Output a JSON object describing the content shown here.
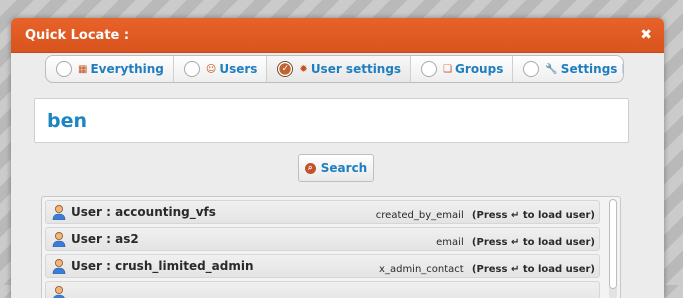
{
  "dialog": {
    "title": "Quick Locate :",
    "close_icon": "close-icon"
  },
  "tabs": [
    {
      "label": "Everything",
      "icon": "grid-icon",
      "selected": false
    },
    {
      "label": "Users",
      "icon": "user-icon",
      "selected": false
    },
    {
      "label": "User settings",
      "icon": "gear-icon",
      "selected": true
    },
    {
      "label": "Groups",
      "icon": "groups-icon",
      "selected": false
    },
    {
      "label": "Settings Panel",
      "icon": "wrench-icon",
      "selected": false
    }
  ],
  "search": {
    "value": "ben",
    "button_label": "Search",
    "button_icon": "search-icon"
  },
  "results": [
    {
      "label": "User : accounting_vfs",
      "field": "created_by_email",
      "hint_pre": "(Press",
      "hint_key": "↵",
      "hint_post": "to load user)"
    },
    {
      "label": "User : as2",
      "field": "email",
      "hint_pre": "(Press",
      "hint_key": "↵",
      "hint_post": "to load user)"
    },
    {
      "label": "User : crush_limited_admin",
      "field": "x_admin_contact",
      "hint_pre": "(Press",
      "hint_key": "↵",
      "hint_post": "to load user)"
    }
  ],
  "colors": {
    "titlebar": "#e05a24",
    "link": "#1f7ec0",
    "accent": "#c4531e"
  }
}
